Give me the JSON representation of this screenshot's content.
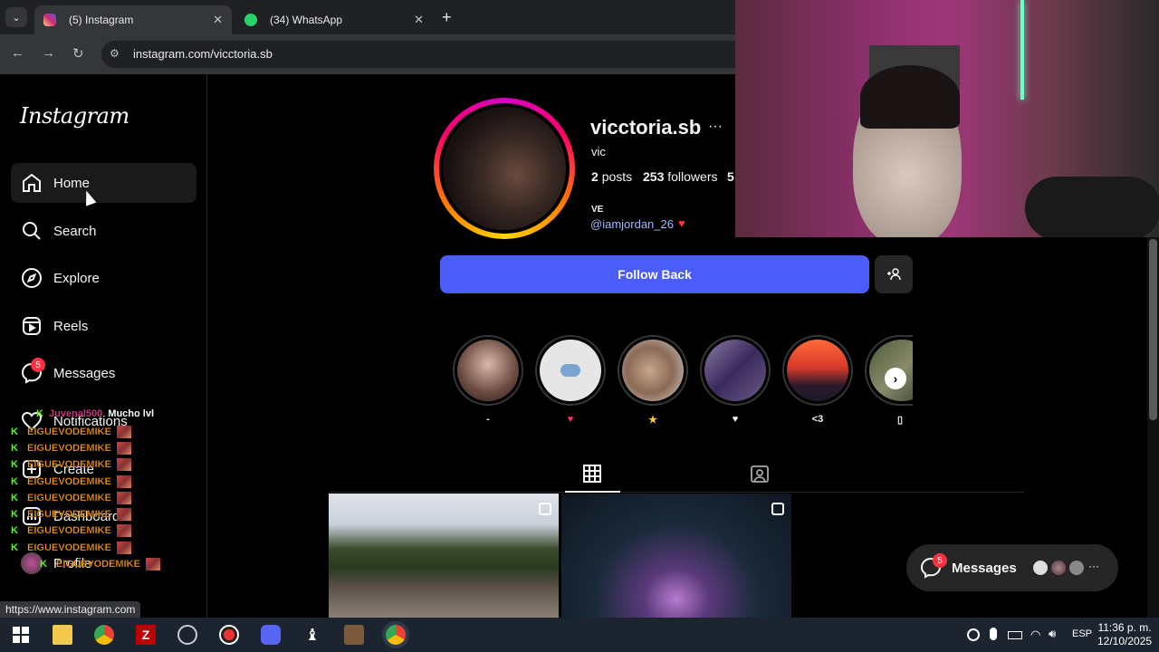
{
  "browser": {
    "tabs": [
      {
        "label": "(5) Instagram",
        "active": true
      },
      {
        "label": "(34) WhatsApp",
        "active": false
      }
    ],
    "url": "instagram.com/vicctoria.sb",
    "status_link": "https://www.instagram.com"
  },
  "sidebar": {
    "logo": "Instagram",
    "items": [
      {
        "label": "Home",
        "icon": "home-icon",
        "active": true
      },
      {
        "label": "Search",
        "icon": "search-icon"
      },
      {
        "label": "Explore",
        "icon": "compass-icon"
      },
      {
        "label": "Reels",
        "icon": "reels-icon"
      },
      {
        "label": "Messages",
        "icon": "messenger-icon",
        "badge": "5"
      },
      {
        "label": "Notifications",
        "icon": "heart-icon"
      },
      {
        "label": "Create",
        "icon": "plus-square-icon"
      },
      {
        "label": "Dashboard",
        "icon": "dashboard-icon"
      },
      {
        "label": "Profile",
        "icon": "avatar-icon"
      }
    ]
  },
  "chat_overlay": {
    "first": {
      "user": "Juvenal500",
      "message": "Mucho lvl"
    },
    "rows": [
      "EIGUEVODEMIKE",
      "EIGUEVODEMIKE",
      "EIGUEVODEMIKE",
      "EIGUEVODEMIKE",
      "EIGUEVODEMIKE",
      "EIGUEVODEMIKE",
      "EIGUEVODEMIKE",
      "EIGUEVODEMIKE",
      "EIGUEVODEMIKE"
    ]
  },
  "profile": {
    "username": "vicctoria.sb",
    "more": "···",
    "full_name": "vic",
    "posts": "2",
    "posts_label": "posts",
    "followers": "253",
    "followers_label": "followers",
    "following_partial": "5",
    "bio_line": "VE",
    "bio_mention": "@iamjordan_26",
    "bio_heart": "♥",
    "follow_button": "Follow Back",
    "suggest_icon": "+person-icon"
  },
  "highlights": [
    {
      "label": "-"
    },
    {
      "label": "♥"
    },
    {
      "label": "★"
    },
    {
      "label": "♥"
    },
    {
      "label": "<3"
    },
    {
      "label": "▯"
    }
  ],
  "messages_pill": {
    "label": "Messages",
    "badge": "5"
  },
  "taskbar": {
    "lang": "ESP",
    "time": "11:36 p. m.",
    "date": "12/10/2025"
  },
  "colors": {
    "follow_button": "#4a5df9",
    "badge": "#ff3040",
    "link": "#a3b8ff",
    "chat_name": "#ff9d00",
    "kick_green": "#53fc18"
  }
}
